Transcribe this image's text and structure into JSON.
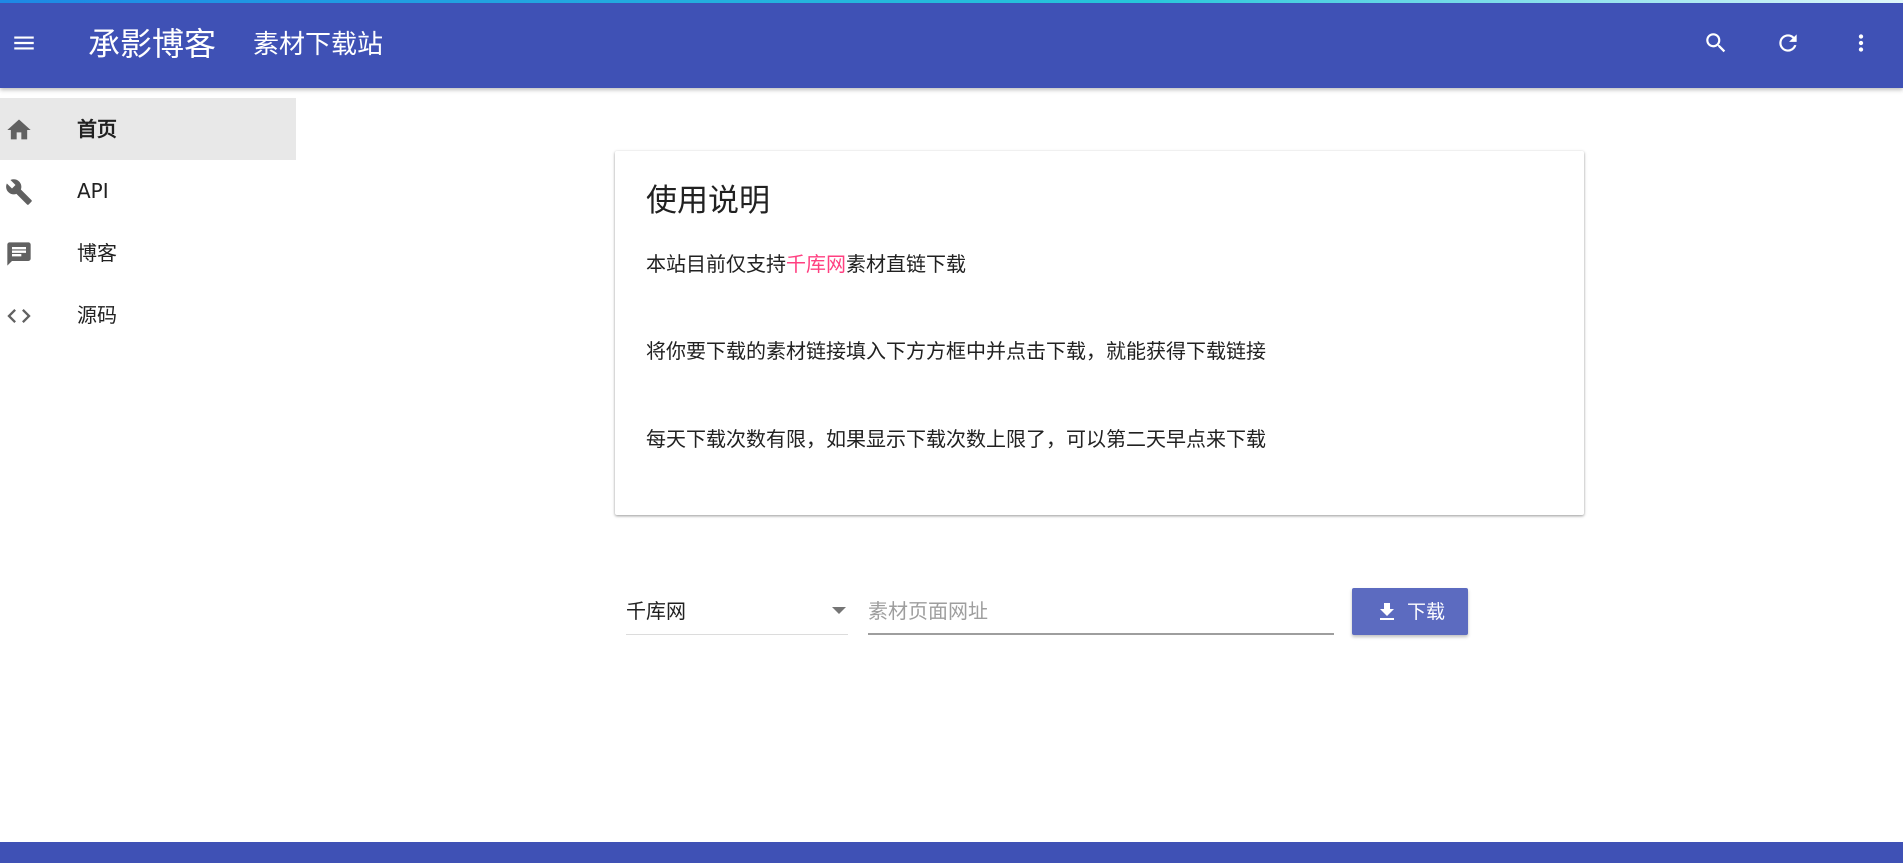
{
  "appbar": {
    "menu_icon": "menu-icon",
    "title": "承影博客",
    "subtitle": "素材下载站",
    "search_icon": "search-icon",
    "refresh_icon": "refresh-icon",
    "more_icon": "more-vert-icon",
    "color": "#3f51b5"
  },
  "sidebar": {
    "items": [
      {
        "label": "首页",
        "icon": "home-icon",
        "active": true
      },
      {
        "label": "API",
        "icon": "wrench-icon",
        "active": false
      },
      {
        "label": "博客",
        "icon": "comment-icon",
        "active": false
      },
      {
        "label": "源码",
        "icon": "code-icon",
        "active": false
      }
    ]
  },
  "card": {
    "title": "使用说明",
    "line1_prefix": "本站目前仅支持",
    "line1_link": "千库网",
    "line1_suffix": "素材直链下载",
    "line2": "将你要下载的素材链接填入下方方框中并点击下载，就能获得下载链接",
    "line3": "每天下载次数有限，如果显示下载次数上限了，可以第二天早点来下载"
  },
  "form": {
    "site_select_value": "千库网",
    "url_placeholder": "素材页面网址",
    "url_value": "",
    "download_label": "下载",
    "download_icon": "download-icon"
  },
  "colors": {
    "primary": "#3f51b5",
    "accent": "#ff4081",
    "button": "#5c6bc0"
  }
}
